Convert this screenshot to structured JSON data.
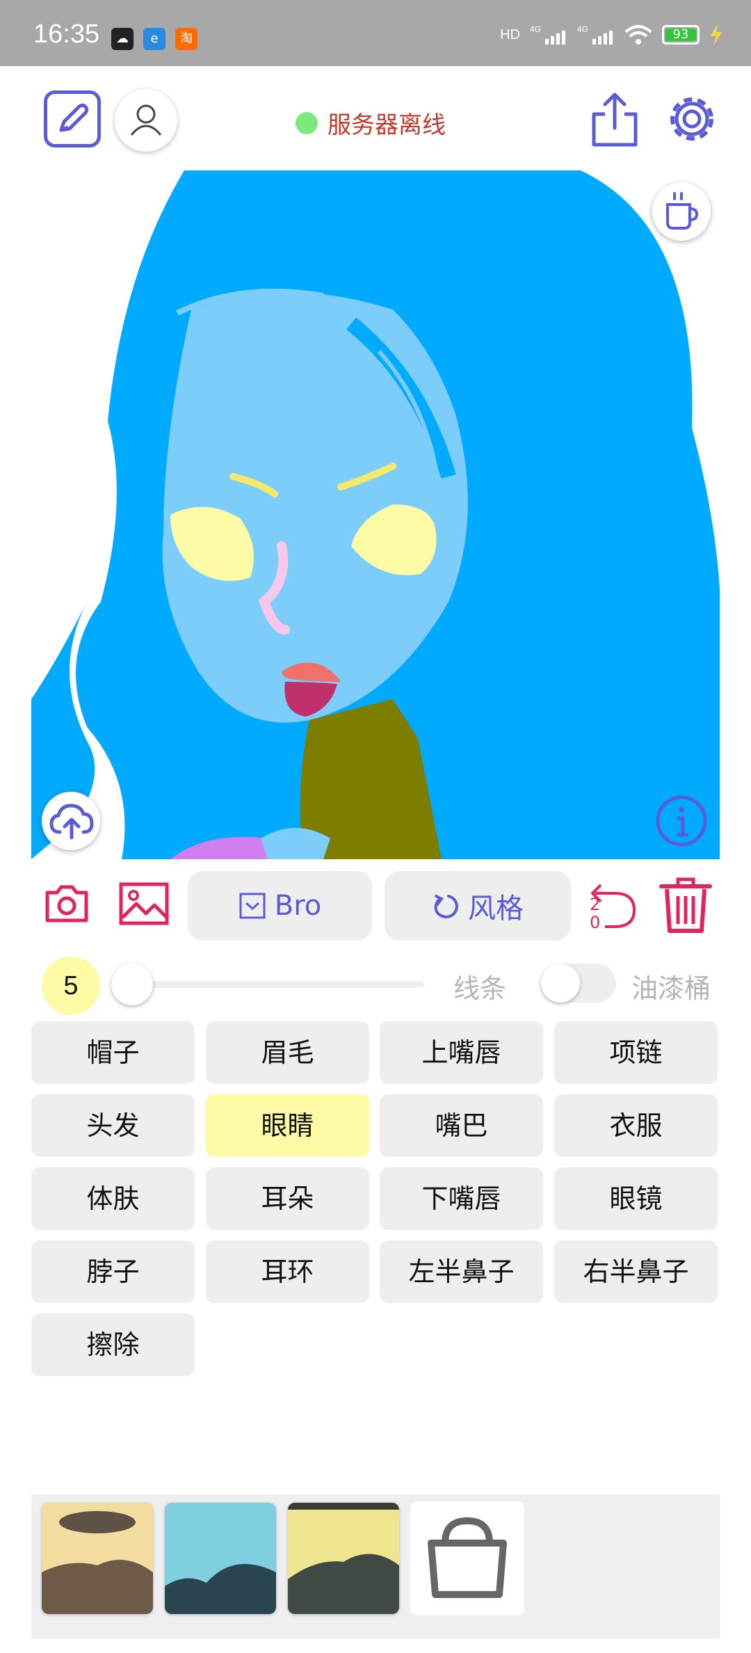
{
  "status_bar": {
    "time": "16:35",
    "app_icons": [
      "cloud-app-icon",
      "browser-app-icon",
      "taobao-app-icon"
    ],
    "taobao_glyph": "淘",
    "network_labels": [
      "HD",
      "4G",
      "4G"
    ],
    "battery_level": "93"
  },
  "header": {
    "server_status": "服务器离线",
    "server_status_color": "#7ee87c",
    "accent_color": "#5b5bd6"
  },
  "toolbar": {
    "brush_label": "Bro",
    "style_label": "风格",
    "undo_count_top": "2",
    "undo_count_bottom": "0",
    "danger_color": "#e0245e"
  },
  "controls": {
    "brush_size": "5",
    "line_label": "线条",
    "bucket_label": "油漆桶"
  },
  "parts": [
    {
      "label": "帽子"
    },
    {
      "label": "眉毛"
    },
    {
      "label": "上嘴唇"
    },
    {
      "label": "项链"
    },
    {
      "label": "头发"
    },
    {
      "label": "眼睛"
    },
    {
      "label": "嘴巴"
    },
    {
      "label": "衣服"
    },
    {
      "label": "体肤"
    },
    {
      "label": "耳朵"
    },
    {
      "label": "下嘴唇"
    },
    {
      "label": "眼镜"
    },
    {
      "label": "脖子"
    },
    {
      "label": "耳环"
    },
    {
      "label": "左半鼻子"
    },
    {
      "label": "右半鼻子"
    },
    {
      "label": "擦除"
    }
  ],
  "selected_part": "眼睛",
  "canvas_colors": {
    "hair": "#00aaff",
    "skin": "#7dcdfb",
    "eyes": "#fffaa5",
    "eyebrows": "#f5e86a",
    "nose": "#f7c8ec",
    "upper_lip": "#f0706a",
    "lower_lip": "#c0306a",
    "neck": "#7d7d00",
    "clothes": "#d37ef0"
  },
  "styles": [
    "style-1",
    "style-2",
    "style-3"
  ]
}
